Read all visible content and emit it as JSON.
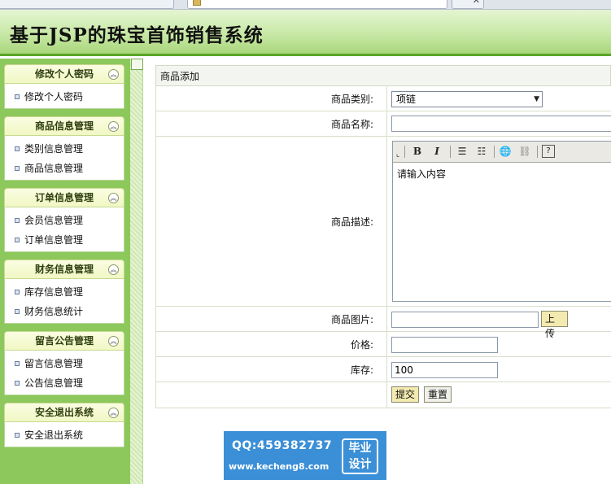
{
  "app": {
    "title": "基于JSP的珠宝首饰销售系统",
    "accent_color": "#5aa528",
    "sidebar_color": "#8cc85c"
  },
  "sidebar": {
    "panels": [
      {
        "title": "修改个人密码",
        "items": [
          "修改个人密码"
        ]
      },
      {
        "title": "商品信息管理",
        "items": [
          "类别信息管理",
          "商品信息管理"
        ]
      },
      {
        "title": "订单信息管理",
        "items": [
          "会员信息管理",
          "订单信息管理"
        ]
      },
      {
        "title": "财务信息管理",
        "items": [
          "库存信息管理",
          "财务信息统计"
        ]
      },
      {
        "title": "留言公告管理",
        "items": [
          "留言信息管理",
          "公告信息管理"
        ]
      },
      {
        "title": "安全退出系统",
        "items": [
          "安全退出系统"
        ]
      }
    ],
    "collapse_icon": "chevron-up-circle-icon"
  },
  "form": {
    "title": "商品添加",
    "category": {
      "label": "商品类别:",
      "value": "项链"
    },
    "name": {
      "label": "商品名称:",
      "value": ""
    },
    "description": {
      "label": "商品描述:",
      "content": "请输入内容",
      "toolbar": [
        "B",
        "I",
        "ordered-list-icon",
        "unordered-list-icon",
        "link-icon",
        "unlink-icon",
        "help-icon"
      ]
    },
    "image": {
      "label": "商品图片:",
      "value": "",
      "upload_label": "上传"
    },
    "price": {
      "label": "价格:",
      "value": ""
    },
    "stock": {
      "label": "库存:",
      "value": "100"
    },
    "submit_label": "提交",
    "reset_label": "重置"
  },
  "watermark": {
    "qq": "QQ:459382737",
    "url": "www.kecheng8.com",
    "badge_line1": "毕业",
    "badge_line2": "设计",
    "color": "#3b8fd7"
  }
}
